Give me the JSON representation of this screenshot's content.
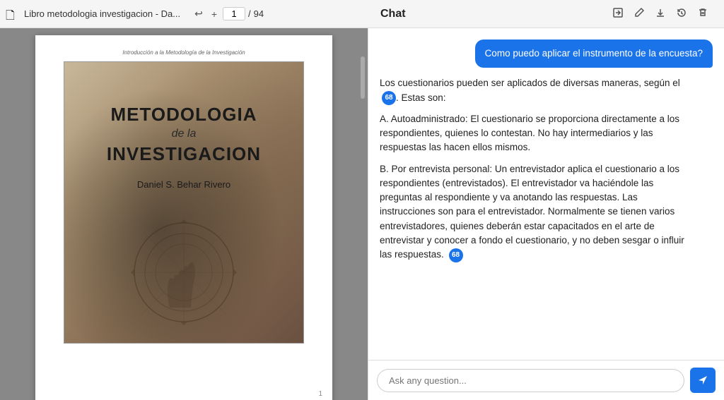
{
  "titleBar": {
    "docIcon": "📄",
    "title": "Libro metodologia investigacion - Da...",
    "undoBtn": "↩",
    "redoBtn": "+",
    "currentPage": "1",
    "totalPages": "94"
  },
  "chat": {
    "title": "Chat",
    "toolbar": {
      "shareIcon": "⬡",
      "editIcon": "✎",
      "downloadIcon": "⬇",
      "historyIcon": "↺",
      "deleteIcon": "🗑"
    },
    "messages": [
      {
        "role": "user",
        "text": "Como puedo aplicar el instrumento de la encuesta?"
      },
      {
        "role": "assistant",
        "paragraphs": [
          "Los cuestionarios pueden ser aplicados de diversas maneras, según el [68]. Estas son:",
          "A. Autoadministrado: El cuestionario se proporciona directamente a los respondientes, quienes lo contestan. No hay intermediarios y las respuestas las hacen ellos mismos.",
          "B. Por entrevista personal: Un entrevistador aplica el cuestionario a los respondientes (entrevistados). El entrevistador va haciéndole las preguntas al respondiente y va anotando las respuestas. Las instrucciones son para el entrevistador. Normalmente se tienen varios entrevistadores, quienes deberán estar capacitados en el arte de entrevistar y conocer a fondo el cuestionario, y no deben sesgar o influir las respuestas. [68]"
        ],
        "citations": [
          68
        ]
      }
    ],
    "inputPlaceholder": "Ask any question...",
    "sendLabel": "Send"
  },
  "pdfPage": {
    "subtitle": "Introducción a la Metodología de la Investigación",
    "bookTitleMain": "METODOLOGIA",
    "bookTitleDe": "de la",
    "bookTitleSub": "INVESTIGACION",
    "bookAuthor": "Daniel S. Behar Rivero",
    "pageNumber": "1"
  }
}
